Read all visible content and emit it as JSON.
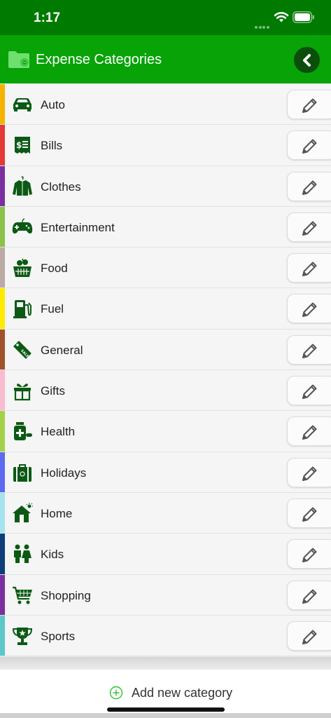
{
  "status_bar": {
    "time": "1:17"
  },
  "header": {
    "title": "Expense Categories"
  },
  "categories": [
    {
      "label": "Auto",
      "color": "#F5B400",
      "icon": "car-icon"
    },
    {
      "label": "Bills",
      "color": "#E53935",
      "icon": "bill-icon"
    },
    {
      "label": "Clothes",
      "color": "#7B2FA0",
      "icon": "jacket-icon"
    },
    {
      "label": "Entertainment",
      "color": "#8BC34A",
      "icon": "gamepad-icon"
    },
    {
      "label": "Food",
      "color": "#BCAAA4",
      "icon": "food-basket-icon"
    },
    {
      "label": "Fuel",
      "color": "#FFEB00",
      "icon": "fuel-pump-icon"
    },
    {
      "label": "General",
      "color": "#A0522D",
      "icon": "sale-tag-icon"
    },
    {
      "label": "Gifts",
      "color": "#F8BBD0",
      "icon": "gift-icon"
    },
    {
      "label": "Health",
      "color": "#A4D14A",
      "icon": "medicine-icon"
    },
    {
      "label": "Holidays",
      "color": "#5C6BF0",
      "icon": "suitcase-icon"
    },
    {
      "label": "Home",
      "color": "#A5E3F0",
      "icon": "house-icon"
    },
    {
      "label": "Kids",
      "color": "#0D3E7A",
      "icon": "kids-icon"
    },
    {
      "label": "Shopping",
      "color": "#7B2FA0",
      "icon": "shopping-cart-icon"
    },
    {
      "label": "Sports",
      "color": "#5CC8C8",
      "icon": "trophy-icon"
    }
  ],
  "footer": {
    "add_label": "Add new category"
  },
  "colors": {
    "header": "#07A307",
    "status_bar": "#007A00",
    "icon": "#0B5A14"
  }
}
